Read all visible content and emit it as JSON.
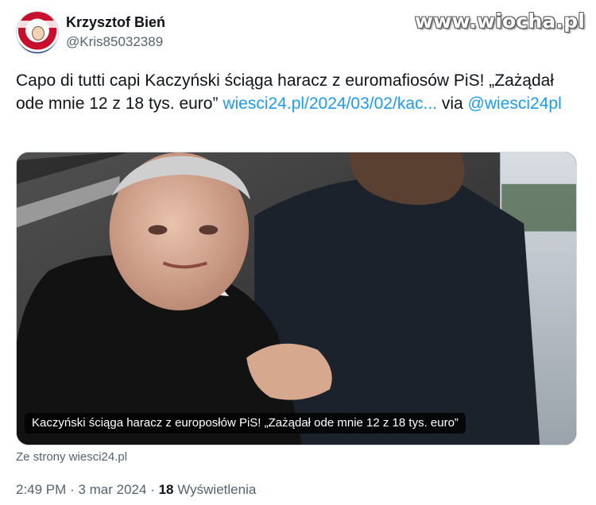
{
  "watermark": "www.wiocha.pl",
  "author": {
    "display_name": "Krzysztof Bień",
    "handle": "@Kris85032389"
  },
  "tweet": {
    "text_part1": "Capo di tutti capi  Kaczyński ściąga haracz z euromafiosów PiS! „Zażądał ode mnie 12 z 18 tys. euro”",
    "link": "wiesci24.pl/2024/03/02/kac...",
    "via": "via",
    "mention": "@wiesci24pl"
  },
  "media": {
    "caption": "Kaczyński ściąga haracz z europosłów PiS! „Zażądał ode mnie 12 z 18 tys. euro”"
  },
  "source": "Ze strony wiesci24.pl",
  "meta": {
    "time": "2:49 PM",
    "dot": "·",
    "date": "3 mar 2024",
    "views_count": "18",
    "views_label": "Wyświetlenia"
  },
  "colors": {
    "link": "#1d9bf0",
    "secondary_text": "#536471",
    "primary_text": "#0f1419"
  }
}
